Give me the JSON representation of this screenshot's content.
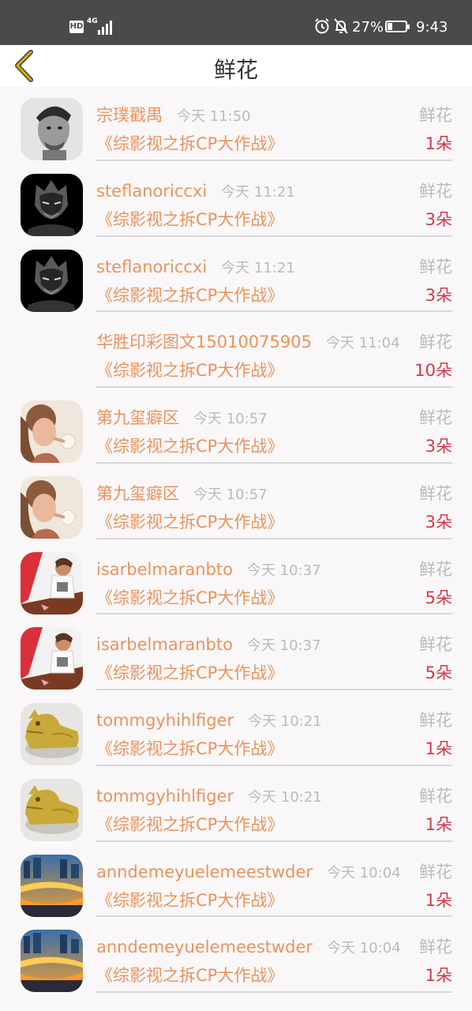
{
  "status_bar": {
    "hd": "HD",
    "network": "4G",
    "battery_percent": "27%",
    "battery_level": 0.27,
    "time": "9:43",
    "icons": [
      "signal-icon",
      "alarm-icon",
      "mute-bell-icon",
      "battery-icon"
    ]
  },
  "header": {
    "title": "鲜花",
    "back_icon": "chevron-left-icon"
  },
  "colors": {
    "name": "#e8945e",
    "count": "#d5384a",
    "muted": "#bbbbbb",
    "back": "#d4b400"
  },
  "rows": [
    {
      "name": "宗璞戳禺",
      "time": "今天 11:50",
      "type": "鲜花",
      "show": "《综影视之拆CP大作战》",
      "count": "1朵",
      "avatar": "man-portrait"
    },
    {
      "name": "steflanoriccxi",
      "time": "今天 11:21",
      "type": "鲜花",
      "show": "《综影视之拆CP大作战》",
      "count": "3朵",
      "avatar": "dark-mask"
    },
    {
      "name": "steflanoriccxi",
      "time": "今天 11:21",
      "type": "鲜花",
      "show": "《综影视之拆CP大作战》",
      "count": "3朵",
      "avatar": "dark-mask"
    },
    {
      "name": "华胜印彩图文15010075905",
      "time": "今天 11:04",
      "type": "鲜花",
      "show": "《综影视之拆CP大作战》",
      "count": "10朵",
      "avatar": "none"
    },
    {
      "name": "第九玺癖区",
      "time": "今天 10:57",
      "type": "鲜花",
      "show": "《综影视之拆CP大作战》",
      "count": "3朵",
      "avatar": "girl-dandelion"
    },
    {
      "name": "第九玺癖区",
      "time": "今天 10:57",
      "type": "鲜花",
      "show": "《综影视之拆CP大作战》",
      "count": "3朵",
      "avatar": "girl-dandelion"
    },
    {
      "name": "isarbelmaranbto",
      "time": "今天 10:37",
      "type": "鲜花",
      "show": "《综影视之拆CP大作战》",
      "count": "5朵",
      "avatar": "girl-red"
    },
    {
      "name": "isarbelmaranbto",
      "time": "今天 10:37",
      "type": "鲜花",
      "show": "《综影视之拆CP大作战》",
      "count": "5朵",
      "avatar": "girl-red"
    },
    {
      "name": "tommgyhihlfiger",
      "time": "今天 10:21",
      "type": "鲜花",
      "show": "《综影视之拆CP大作战》",
      "count": "1朵",
      "avatar": "gold-lion"
    },
    {
      "name": "tommgyhihlfiger",
      "time": "今天 10:21",
      "type": "鲜花",
      "show": "《综影视之拆CP大作战》",
      "count": "1朵",
      "avatar": "gold-lion"
    },
    {
      "name": "anndemeyuelemeestwder",
      "time": "今天 10:04",
      "type": "鲜花",
      "show": "《综影视之拆CP大作战》",
      "count": "1朵",
      "avatar": "city-night"
    },
    {
      "name": "anndemeyuelemeestwder",
      "time": "今天 10:04",
      "type": "鲜花",
      "show": "《综影视之拆CP大作战》",
      "count": "1朵",
      "avatar": "city-night"
    }
  ]
}
